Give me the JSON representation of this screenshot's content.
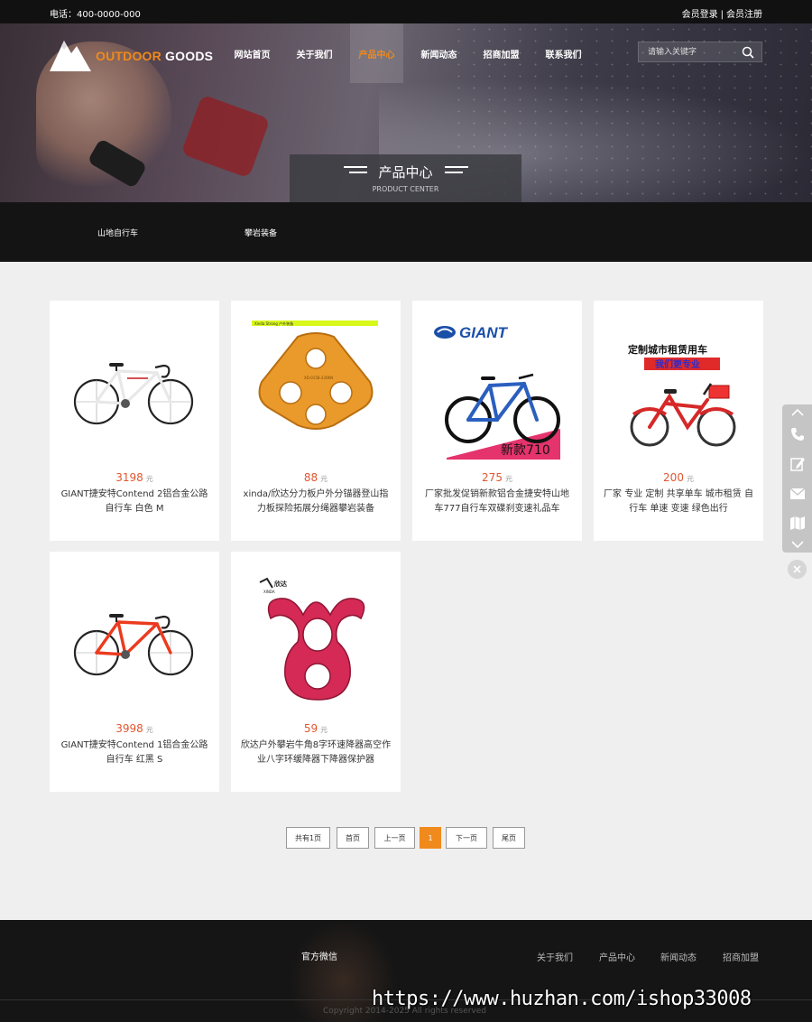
{
  "topbar": {
    "phone": "电话：400-0000-000",
    "login": "会员登录",
    "separator": "|",
    "register": "会员注册"
  },
  "logo": {
    "brand_orange": "OUTDOOR",
    "brand_white": "GOODS"
  },
  "nav": [
    "网站首页",
    "关于我们",
    "产品中心",
    "新闻动态",
    "招商加盟",
    "联系我们"
  ],
  "nav_active": "产品中心",
  "search": {
    "placeholder": "请输入关键字",
    "icon": "search-icon"
  },
  "page_title": {
    "cn": "产品中心",
    "en": "PRODUCT CENTER"
  },
  "categories": [
    "山地自行车",
    "攀岩装备"
  ],
  "products": [
    {
      "price": "3198",
      "unit": "元",
      "name": "GIANT捷安特Contend 2铝合金公路自行车 白色 M"
    },
    {
      "price": "88",
      "unit": "元",
      "name": "xinda/欣达分力板户外分锚器登山指力板探险拓展分绳器攀岩装备"
    },
    {
      "price": "275",
      "unit": "元",
      "name": "厂家批发促销新款铝合金捷安特山地车777自行车双碟刹变速礼品车"
    },
    {
      "price": "200",
      "unit": "元",
      "name": "厂家 专业 定制 共享单车 城市租赁 自行车 单速 变速 绿色出行"
    },
    {
      "price": "3998",
      "unit": "元",
      "name": "GIANT捷安特Contend 1铝合金公路自行车 红黑 S"
    },
    {
      "price": "59",
      "unit": "元",
      "name": "欣达户外攀岩牛角8字环速降器高空作业八字环缓降器下降器保护器"
    }
  ],
  "product_image_text": {
    "plate_label": "Xinda Strong 户外装备",
    "plate_code": "XD-0158-230KN",
    "giant_logo": "GIANT",
    "giant_badge": "新款710",
    "rental_title": "定制城市租赁用车",
    "rental_sub": "我们更专业",
    "rack_brand": "欣达",
    "rack_brand_en": "XINDA"
  },
  "pagination": {
    "total": "共有1页",
    "first": "首页",
    "prev": "上一页",
    "current": "1",
    "next": "下一页",
    "last": "尾页"
  },
  "sidebar_tools": [
    "chevron-up-icon",
    "phone-icon",
    "edit-icon",
    "mail-icon",
    "map-icon",
    "chevron-down-icon"
  ],
  "close_icon": "close-icon",
  "footer": {
    "wechat": "官方微信",
    "links": [
      "关于我们",
      "产品中心",
      "新闻动态",
      "招商加盟"
    ],
    "copyright": "Copyright 2014-2025   All rights reserved"
  },
  "watermark": "https://www.huzhan.com/ishop33008",
  "colors": {
    "accent": "#f08a1c",
    "price": "#e2552f",
    "dark": "#141414"
  }
}
